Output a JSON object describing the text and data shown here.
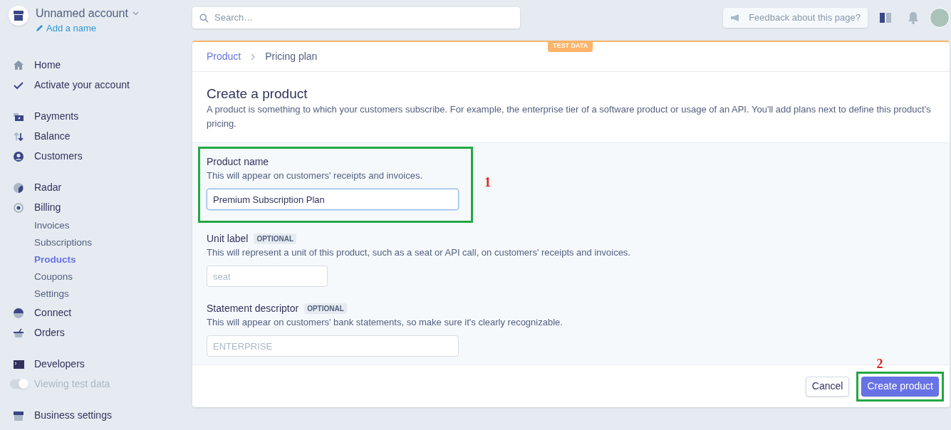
{
  "account": {
    "name": "Unnamed account",
    "add_name": "Add a name"
  },
  "nav": [
    [
      {
        "label": "Home",
        "selected": false
      },
      {
        "label": "Activate your account",
        "selected": false
      }
    ],
    [
      {
        "label": "Payments",
        "selected": false
      },
      {
        "label": "Balance",
        "selected": false
      },
      {
        "label": "Customers",
        "selected": false
      }
    ],
    [
      {
        "label": "Radar",
        "selected": false
      },
      {
        "label": "Billing",
        "selected": false,
        "children": [
          {
            "label": "Invoices",
            "selected": false
          },
          {
            "label": "Subscriptions",
            "selected": false
          },
          {
            "label": "Products",
            "selected": true
          },
          {
            "label": "Coupons",
            "selected": false
          },
          {
            "label": "Settings",
            "selected": false
          }
        ]
      },
      {
        "label": "Connect",
        "selected": false
      },
      {
        "label": "Orders",
        "selected": false
      }
    ],
    [
      {
        "label": "Developers",
        "selected": false
      },
      {
        "label": "Viewing test data",
        "kind": "toggle",
        "on": true
      }
    ],
    [
      {
        "label": "Business settings",
        "selected": false
      }
    ]
  ],
  "search": {
    "placeholder": "Search…"
  },
  "feedback": "Feedback about this page?",
  "test_badge": "TEST DATA",
  "breadcrumb": [
    {
      "label": "Product",
      "selected": false
    },
    {
      "label": "Pricing plan",
      "selected": true
    }
  ],
  "title": "Create a product",
  "description": "A product is something to which your customers subscribe. For example, the enterprise tier of a software product or usage of an API. You'll add plans next to define this product's pricing.",
  "fields": [
    {
      "label": "Product name",
      "hint": "This will appear on customers' receipts and invoices.",
      "value": "Premium Subscription Plan",
      "kind": "wide",
      "focused": true,
      "highlight": "1"
    },
    {
      "label": "Unit label",
      "badge": "OPTIONAL",
      "hint": "This will represent a unit of this product, such as a seat or API call, on customers' receipts and invoices.",
      "placeholder": "seat",
      "kind": "narrow",
      "focused": false
    },
    {
      "label": "Statement descriptor",
      "badge": "OPTIONAL",
      "hint": "This will appear on customers' bank statements, so make sure it's clearly recognizable.",
      "placeholder": "ENTERPRISE",
      "kind": "wide",
      "focused": false
    }
  ],
  "buttons": [
    {
      "label": "Cancel",
      "kind": "secondary"
    },
    {
      "label": "Create product",
      "kind": "primary",
      "highlight": "2"
    }
  ]
}
